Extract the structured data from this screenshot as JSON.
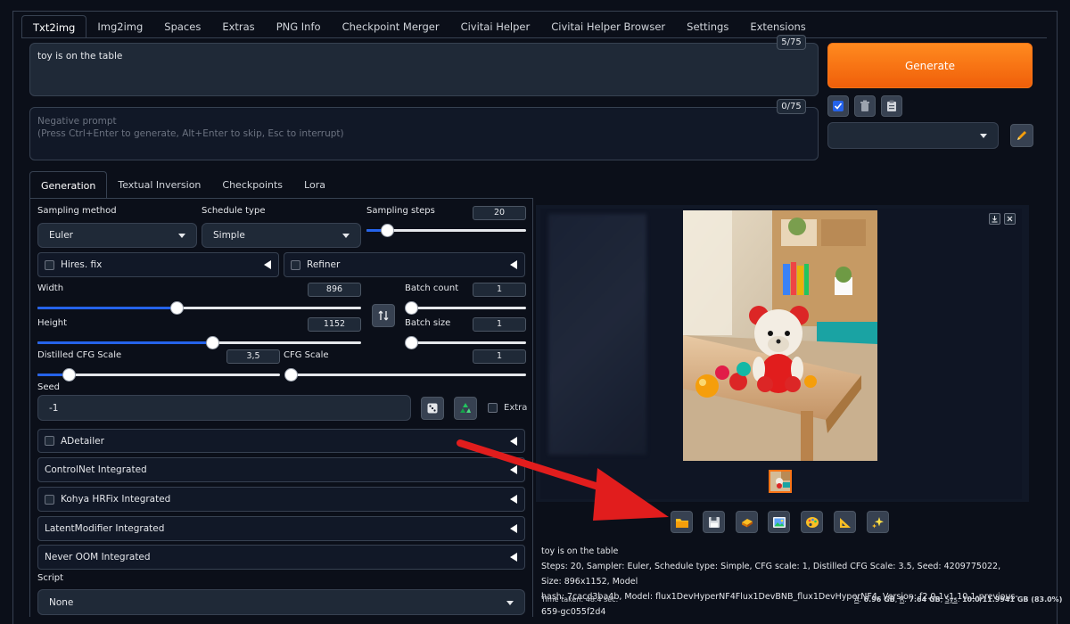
{
  "top_tabs": [
    "Txt2img",
    "Img2img",
    "Spaces",
    "Extras",
    "PNG Info",
    "Checkpoint Merger",
    "Civitai Helper",
    "Civitai Helper Browser",
    "Settings",
    "Extensions"
  ],
  "prompt": {
    "value": "toy is on the table",
    "counter": "5/75"
  },
  "negative_prompt": {
    "placeholder_line1": "Negative prompt",
    "placeholder_line2": "(Press Ctrl+Enter to generate, Alt+Enter to skip, Esc to interrupt)",
    "counter": "0/75"
  },
  "generate_label": "Generate",
  "sub_tabs": [
    "Generation",
    "Textual Inversion",
    "Checkpoints",
    "Lora"
  ],
  "sampling": {
    "method_label": "Sampling method",
    "method_value": "Euler",
    "schedule_label": "Schedule type",
    "schedule_value": "Simple",
    "steps_label": "Sampling steps",
    "steps_value": "20",
    "steps_fraction": 0.13
  },
  "hires_label": "Hires. fix",
  "refiner_label": "Refiner",
  "width": {
    "label": "Width",
    "value": "896",
    "fraction": 0.43
  },
  "height": {
    "label": "Height",
    "value": "1152",
    "fraction": 0.54
  },
  "batch_count": {
    "label": "Batch count",
    "value": "1",
    "fraction": 0.0
  },
  "batch_size": {
    "label": "Batch size",
    "value": "1",
    "fraction": 0.0
  },
  "distilled_cfg": {
    "label": "Distilled CFG Scale",
    "value": "3,5",
    "fraction": 0.13
  },
  "cfg": {
    "label": "CFG Scale",
    "value": "1",
    "fraction": 0.0
  },
  "seed": {
    "label": "Seed",
    "value": "-1",
    "extra_label": "Extra"
  },
  "accordions": [
    {
      "label": "ADetailer",
      "checkbox": true
    },
    {
      "label": "ControlNet Integrated",
      "checkbox": false
    },
    {
      "label": "Kohya HRFix Integrated",
      "checkbox": true
    },
    {
      "label": "LatentModifier Integrated",
      "checkbox": false
    },
    {
      "label": "Never OOM Integrated",
      "checkbox": false
    }
  ],
  "script": {
    "label": "Script",
    "value": "None"
  },
  "output": {
    "prompt": "toy is on the table",
    "params_line1": "Steps: 20, Sampler: Euler, Schedule type: Simple, CFG scale: 1, Distilled CFG Scale: 3.5, Seed: 4209775022, Size: 896x1152, Model",
    "params_line2": "hash: 7cacd3ba4b, Model: flux1DevHyperNF4Flux1DevBNB_flux1DevHyperNF4, Version: f2.0.1v1.10.1-previous-659-gc055f2d4",
    "time": "Time taken: 48.4 sec.",
    "mem_a_label": "A",
    "mem_a": "6.96 GB",
    "mem_r_label": "R",
    "mem_r": "7.64 GB",
    "mem_sys_label": "Sys",
    "mem_sys": "10.0/11.9941 GB (83.0%)"
  }
}
